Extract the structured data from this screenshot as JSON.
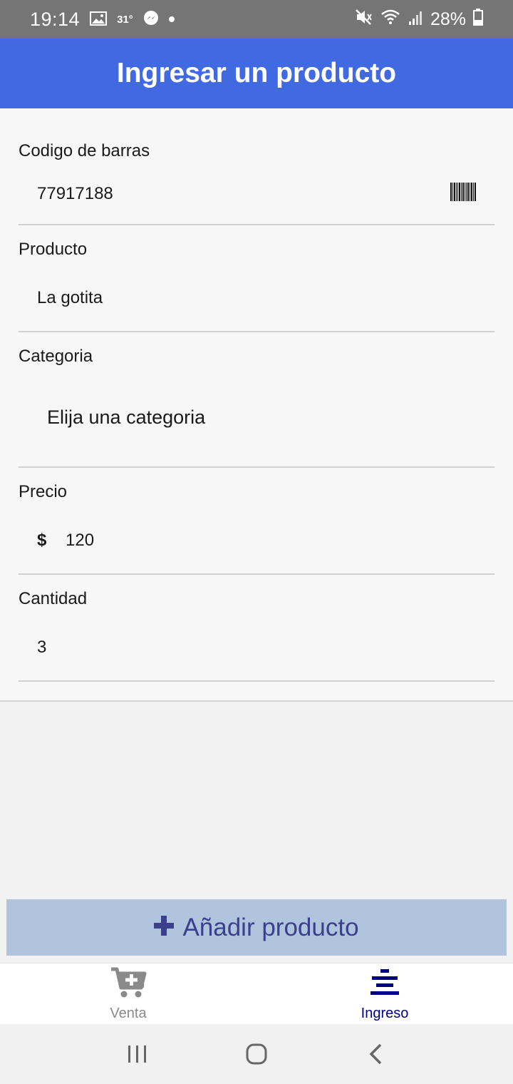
{
  "status_bar": {
    "time": "19:14",
    "temperature": "31°",
    "battery": "28%",
    "icons": [
      "gallery-icon",
      "temperature-icon",
      "messenger-icon",
      "notification-dot-icon",
      "mute-icon",
      "wifi-icon",
      "signal-icon",
      "battery-icon"
    ]
  },
  "header": {
    "title": "Ingresar un producto"
  },
  "form": {
    "barcode": {
      "label": "Codigo de barras",
      "value": "77917188",
      "icon": "barcode-icon"
    },
    "product": {
      "label": "Producto",
      "value": "La gotita"
    },
    "category": {
      "label": "Categoria",
      "selected": "Elija una categoria"
    },
    "price": {
      "label": "Precio",
      "currency": "$",
      "value": "120"
    },
    "quantity": {
      "label": "Cantidad",
      "value": "3"
    }
  },
  "add_button": {
    "label": "Añadir producto",
    "icon": "plus-icon"
  },
  "tabs": [
    {
      "label": "Venta",
      "icon": "cart-plus-icon",
      "active": false
    },
    {
      "label": "Ingreso",
      "icon": "align-center-icon",
      "active": true
    }
  ],
  "colors": {
    "app_bar": "#4169e1",
    "button_bg": "#b0c4de",
    "button_text": "#3b3f8e",
    "active_tab": "#000080",
    "inactive_tab": "#8a8a8a"
  },
  "system_nav": [
    "recent-apps-icon",
    "home-icon",
    "back-icon"
  ]
}
